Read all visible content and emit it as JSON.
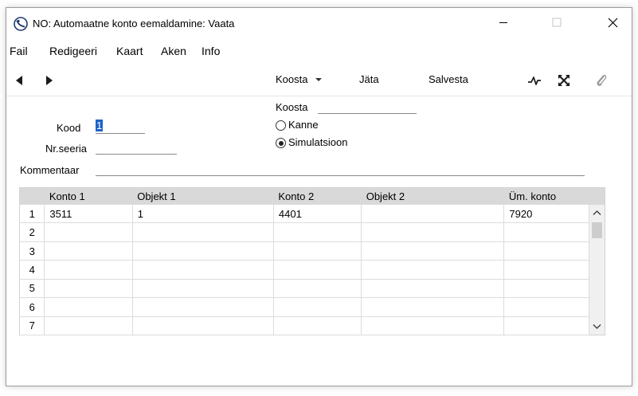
{
  "window": {
    "title": "NO: Automaatne konto eemaldamine: Vaata",
    "controls": [
      "minimize-icon",
      "maximize-icon",
      "close-icon"
    ]
  },
  "menu": {
    "items": [
      {
        "label": "Fail"
      },
      {
        "label": "Redigeeri"
      },
      {
        "label": "Kaart"
      },
      {
        "label": "Aken"
      },
      {
        "label": "Info"
      }
    ]
  },
  "toolbar": {
    "koosta_label": "Koosta",
    "jata_label": "Jäta",
    "salvesta_label": "Salvesta",
    "icons": [
      "prev-arrow-icon",
      "next-arrow-icon",
      "activity-icon",
      "expand-icon",
      "paperclip-icon"
    ]
  },
  "form": {
    "kood_label": "Kood",
    "kood_value": "1",
    "nrseeria_label": "Nr.seeria",
    "nrseeria_value": "",
    "kommentaar_label": "Kommentaar",
    "kommentaar_value": "",
    "koosta_label": "Koosta",
    "koosta_value": "",
    "radio_kanne": "Kanne",
    "radio_simulatsioon": "Simulatsioon",
    "selected_radio": "Simulatsioon"
  },
  "grid": {
    "headers": [
      "",
      "Konto 1",
      "Objekt 1",
      "Konto 2",
      "Objekt 2",
      "Üm. konto"
    ],
    "rows": [
      [
        "1",
        "3511",
        "1",
        "4401",
        "",
        "7920"
      ],
      [
        "2",
        "",
        "",
        "",
        "",
        ""
      ],
      [
        "3",
        "",
        "",
        "",
        "",
        ""
      ],
      [
        "4",
        "",
        "",
        "",
        "",
        ""
      ],
      [
        "5",
        "",
        "",
        "",
        "",
        ""
      ],
      [
        "6",
        "",
        "",
        "",
        "",
        ""
      ],
      [
        "7",
        "",
        "",
        "",
        "",
        ""
      ]
    ]
  },
  "colors": {
    "selection": "#1e64c8",
    "grid_header": "#d9d9d9",
    "window_border": "#9a9a9a"
  }
}
